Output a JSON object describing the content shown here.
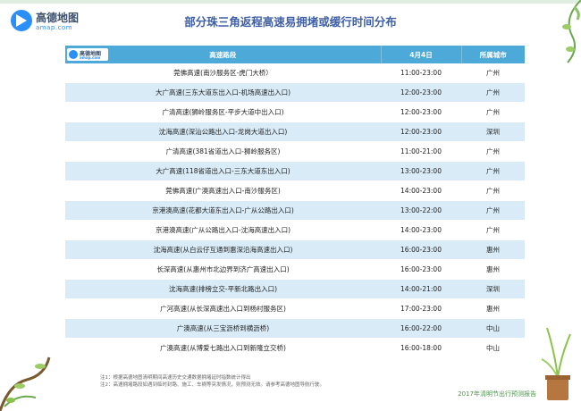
{
  "title": "部分珠三角返程高速易拥堵或缓行时间分布",
  "logo": {
    "zh": "高德地图",
    "en": "amap.com"
  },
  "table": {
    "logo_zh": "高德地图",
    "logo_en": "amap.com",
    "headers": [
      "高速路段",
      "4月4日",
      "所属城市"
    ],
    "rows": [
      [
        "莞佛高速(南沙服务区-虎门大桥）",
        "11:00-23:00",
        "广州"
      ],
      [
        "大广高速(三东大道东出入口-机场高速出入口)",
        "12:00-23:00",
        "广州"
      ],
      [
        "广清高速(狮岭服务区-平步大道中出入口)",
        "12:00-23:00",
        "广州"
      ],
      [
        "沈海高速(深汕公路出入口-龙岗大道出入口)",
        "12:00-23:00",
        "深圳"
      ],
      [
        "广清高速(381省道出入口-狮岭服务区)",
        "11:00-21:00",
        "广州"
      ],
      [
        "大广高速(118省道出入口-三东大道东出入口)",
        "13:00-23:00",
        "广州"
      ],
      [
        "莞佛高速(广澳高速出入口-南沙服务区)",
        "14:00-23:00",
        "广州"
      ],
      [
        "京港澳高速(花都大道东出入口-广从公路出入口)",
        "13:00-22:00",
        "广州"
      ],
      [
        "京港澳高速(广从公路出入口-沈海高速出入口)",
        "14:00-23:00",
        "广州"
      ],
      [
        "沈海高速(从白云仔互通到惠深沿海高速出入口)",
        "16:00-23:00",
        "惠州"
      ],
      [
        "长深高速(从惠州市北边界到济广高速出入口)",
        "16:00-23:00",
        "惠州"
      ],
      [
        "沈海高速(排榜立交-平新北路出入口)",
        "14:00-21:00",
        "深圳"
      ],
      [
        "广河高速(从长深高速出入口到杨村服务区)",
        "17:00-23:00",
        "惠州"
      ],
      [
        "广澳高速(从三宝沥桥到横沥桥)",
        "16:00-22:00",
        "中山"
      ],
      [
        "广澳高速(从博爱七路出入口到新隆立交桥)",
        "16:00-18:00",
        "中山"
      ]
    ]
  },
  "notes": [
    "注1：根据高德地图清明期间高速历史交通数据拥堵延时指数统计得出",
    "注2：高速拥堵路段如遇到临时封路、施工、车祸等突发情况，则预测无效。请参考高德地图导航行驶。"
  ],
  "footer": "2017年清明节出行预测报告"
}
